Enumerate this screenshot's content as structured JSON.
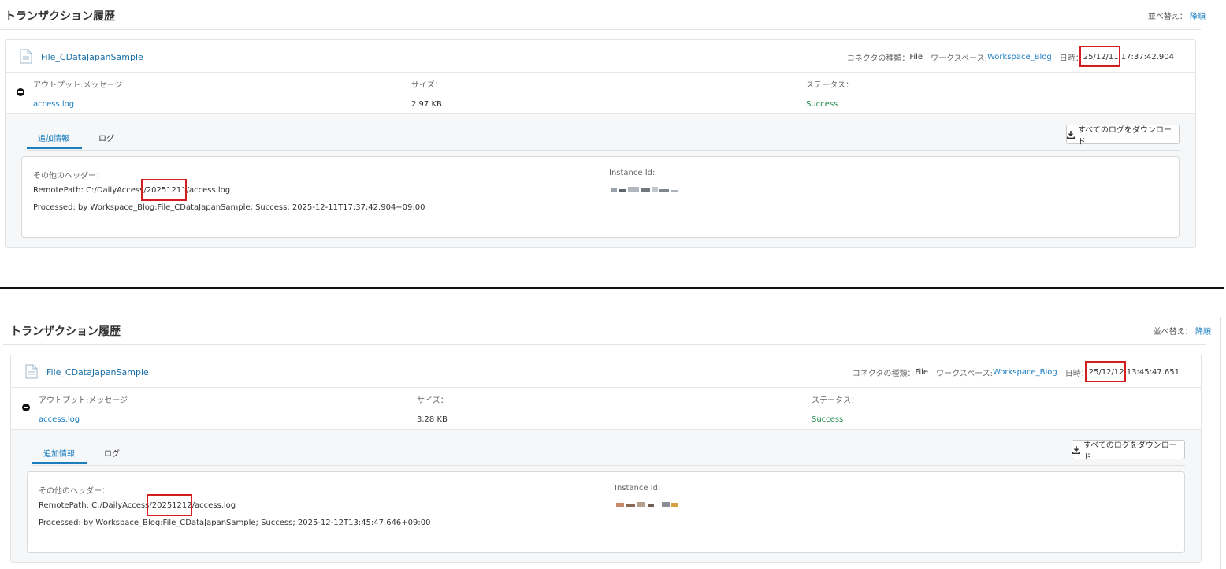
{
  "panels": [
    {
      "page_title": "トランザクション履歴",
      "sort_label": "並べ替え：",
      "sort_value": "降順",
      "file_name": "File_CDataJapanSample",
      "connector_label": "コネクタの種類：",
      "connector_value": "File",
      "workspace_label": "ワークスペース:",
      "workspace_value": "Workspace_Blog",
      "date_label": "日時：",
      "date_value": "25/12/11 17:37:42.904",
      "output_label": "アウトプット:メッセージ",
      "output_value": "access.log",
      "size_label": "サイズ：",
      "size_value": "2.97 KB",
      "status_label": "ステータス：",
      "status_value": "Success",
      "tab_info": "追加情報",
      "tab_log": "ログ",
      "download_label": "すべてのログをダウンロード",
      "headers_label": "その他のヘッダー：",
      "remote_path": "RemotePath: C:/DailyAccess/20251211/access.log",
      "processed": "Processed: by Workspace_Blog:File_CDataJapanSample; Success; 2025-12-11T17:37:42.904+09:00",
      "instance_label": "Instance Id:"
    },
    {
      "page_title": "トランザクション履歴",
      "sort_label": "並べ替え：",
      "sort_value": "降順",
      "file_name": "File_CDataJapanSample",
      "connector_label": "コネクタの種類：",
      "connector_value": "File",
      "workspace_label": "ワークスペース:",
      "workspace_value": "Workspace_Blog",
      "date_label": "日時：",
      "date_value": "25/12/12 13:45:47.651",
      "output_label": "アウトプット:メッセージ",
      "output_value": "access.log",
      "size_label": "サイズ：",
      "size_value": "3.28 KB",
      "status_label": "ステータス：",
      "status_value": "Success",
      "tab_info": "追加情報",
      "tab_log": "ログ",
      "download_label": "すべてのログをダウンロード",
      "headers_label": "その他のヘッダー：",
      "remote_path": "RemotePath: C:/DailyAccess/20251212/access.log",
      "processed": "Processed: by Workspace_Blog:File_CDataJapanSample; Success; 2025-12-12T13:45:47.646+09:00",
      "instance_label": "Instance Id:"
    }
  ],
  "colors": {
    "accent": "#1a7dc0",
    "success": "#1f8a4c",
    "highlight": "#d21e1e"
  },
  "icons": [
    "file-icon",
    "collapse-icon",
    "download-icon"
  ]
}
